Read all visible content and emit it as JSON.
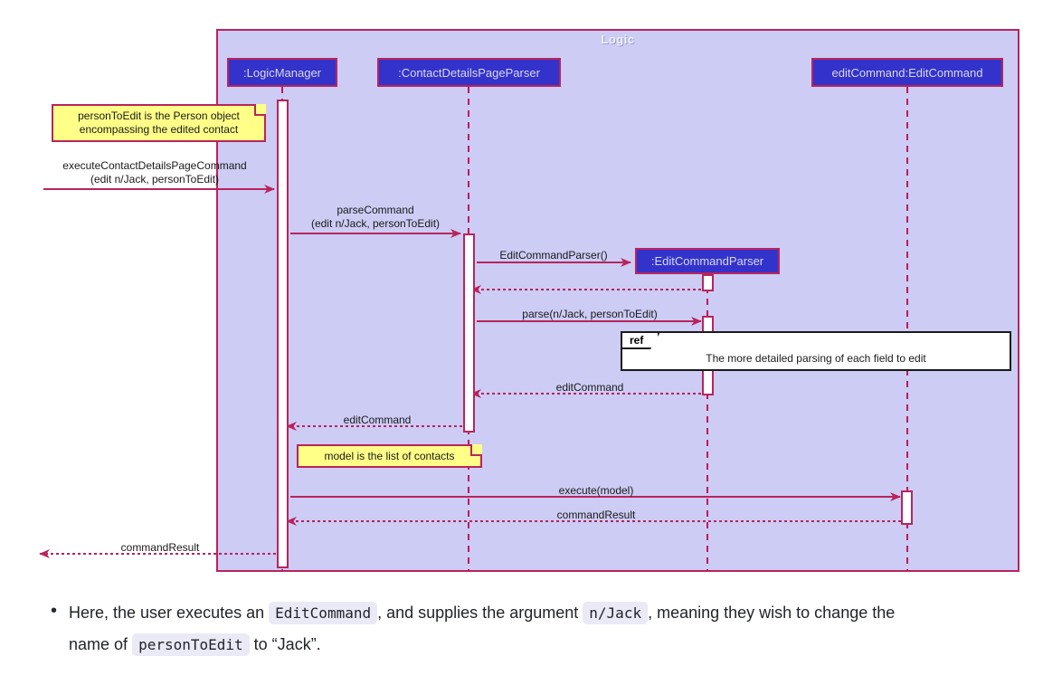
{
  "diagram": {
    "type": "uml-sequence-diagram",
    "package": {
      "label": "Logic"
    },
    "participants": [
      {
        "id": "logicManager",
        "label": ":LogicManager"
      },
      {
        "id": "contactDetailsPageParser",
        "label": ":ContactDetailsPageParser"
      },
      {
        "id": "editCommandParser",
        "label": ":EditCommandParser"
      },
      {
        "id": "editCommand",
        "label": "editCommand:EditCommand"
      }
    ],
    "notes": [
      {
        "id": "note-person-to-edit",
        "line1": "personToEdit is the Person object",
        "line2": "encompassing the edited contact"
      },
      {
        "id": "note-model",
        "line1": "model is the list of contacts",
        "line2": ""
      }
    ],
    "messages": [
      {
        "id": "m1",
        "line1": "executeContactDetailsPageCommand",
        "line2": "(edit n/Jack, personToEdit)",
        "kind": "call"
      },
      {
        "id": "m2",
        "line1": "parseCommand",
        "line2": "(edit n/Jack, personToEdit)",
        "kind": "call"
      },
      {
        "id": "m3",
        "line1": "EditCommandParser()",
        "line2": "",
        "kind": "create"
      },
      {
        "id": "m4",
        "line1": "",
        "line2": "",
        "kind": "return"
      },
      {
        "id": "m5",
        "line1": "parse(n/Jack, personToEdit)",
        "line2": "",
        "kind": "call"
      },
      {
        "id": "m6",
        "line1": "editCommand",
        "line2": "",
        "kind": "return"
      },
      {
        "id": "m7",
        "line1": "editCommand",
        "line2": "",
        "kind": "return"
      },
      {
        "id": "m8",
        "line1": "execute(model)",
        "line2": "",
        "kind": "call"
      },
      {
        "id": "m9",
        "line1": "commandResult",
        "line2": "",
        "kind": "return"
      },
      {
        "id": "m10",
        "line1": "commandResult",
        "line2": "",
        "kind": "return"
      }
    ],
    "ref_fragment": {
      "tab_label": "ref",
      "body_text": "The more detailed parsing of each field to edit"
    },
    "colors": {
      "package_fill": "#ccccf5",
      "package_border": "#b8245c",
      "participant_fill": "#3333cc",
      "participant_text": "#d8d8e8",
      "note_fill": "#ffff88",
      "arrow": "#b8245c",
      "lifeline": "#c2185b",
      "activation_fill": "#ffffff",
      "ref_border": "#1a1a1a"
    }
  },
  "caption": {
    "bullet_marker": "•",
    "part1": "Here, the user executes an",
    "code1": "EditCommand",
    "part2": ", and supplies the argument",
    "code2": "n/Jack",
    "part3": ", meaning they wish to change the name of",
    "code3": "personToEdit",
    "part4": "to “Jack”."
  }
}
